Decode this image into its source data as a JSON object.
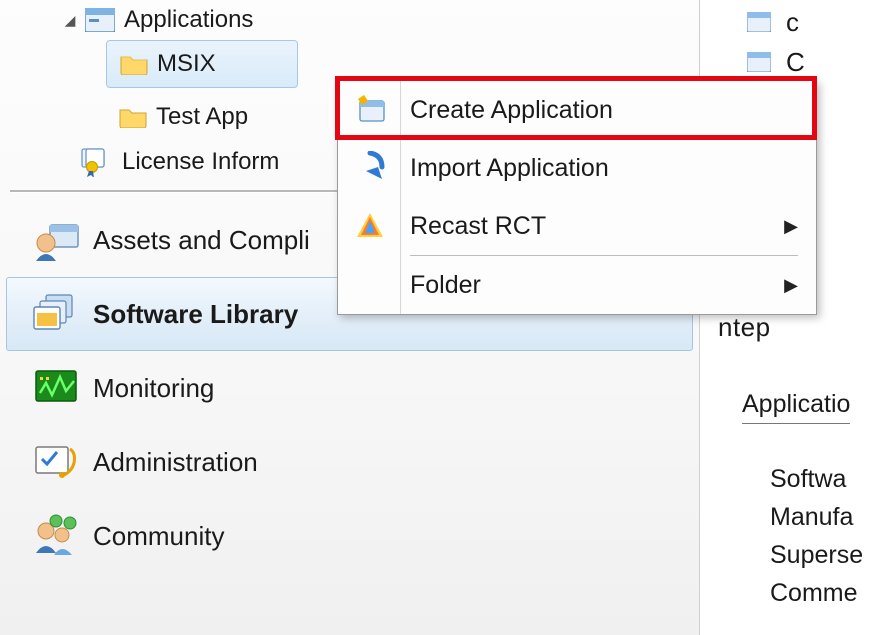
{
  "tree": {
    "applications": {
      "label": "Applications",
      "expanded": true,
      "children": [
        {
          "label": "MSIX",
          "selected": true
        },
        {
          "label": "Test App",
          "selected": false
        }
      ]
    },
    "license_info": {
      "label": "License Inform"
    }
  },
  "nav": {
    "items": [
      {
        "id": "assets",
        "label": "Assets and Compli"
      },
      {
        "id": "software",
        "label": "Software Library",
        "active": true
      },
      {
        "id": "monitor",
        "label": "Monitoring"
      },
      {
        "id": "admin",
        "label": "Administration"
      },
      {
        "id": "community",
        "label": "Community"
      }
    ]
  },
  "context_menu": {
    "items": [
      {
        "id": "create-app",
        "label": "Create Application",
        "highlighted": true
      },
      {
        "id": "import-app",
        "label": "Import Application"
      },
      {
        "id": "recast",
        "label": "Recast RCT",
        "submenu": true
      },
      {
        "id": "folder",
        "label": "Folder",
        "submenu": true
      }
    ]
  },
  "right": {
    "top_rows": [
      {
        "text": "c"
      },
      {
        "text": "C"
      }
    ],
    "band_text": "ntep",
    "section_heading": "Applicatio",
    "fields": [
      "Softwa",
      "Manufa",
      "Superse",
      "Comme"
    ]
  }
}
